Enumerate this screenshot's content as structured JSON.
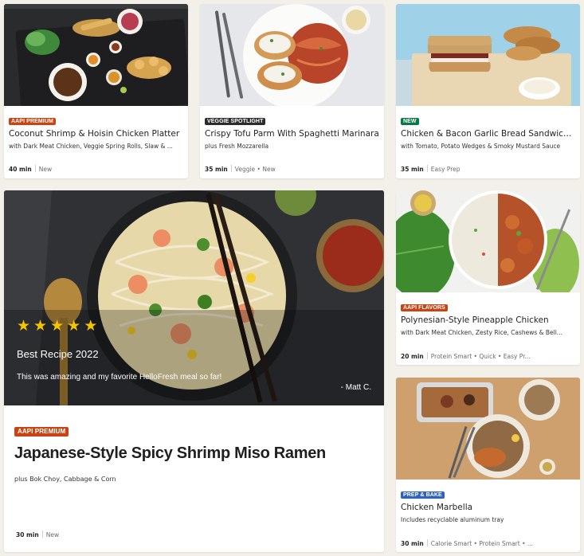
{
  "cards": [
    {
      "badge": "AAPI PREMIUM",
      "title": "Coconut Shrimp & Hoisin Chicken Platter",
      "subtitle": "with Dark Meat Chicken, Veggie Spring Rolls, Slaw & ...",
      "time": "40 min",
      "tags": "New"
    },
    {
      "badge": "VEGGIE SPOTLIGHT",
      "title": "Crispy Tofu Parm With Spaghetti Marinara",
      "subtitle": "plus Fresh Mozzarella",
      "time": "35 min",
      "tags": "Veggie • New"
    },
    {
      "badge": "NEW",
      "title": "Chicken & Bacon Garlic Bread Sandwich...",
      "subtitle": "with Tomato, Potato Wedges & Smoky Mustard Sauce",
      "time": "35 min",
      "tags": "Easy Prep"
    },
    {
      "badge": "AAPI FLAVORS",
      "title": "Polynesian-Style Pineapple Chicken",
      "subtitle": "with Dark Meat Chicken, Zesty Rice, Cashews & Bell...",
      "time": "20 min",
      "tags": "Protein Smart • Quick • Easy Pr..."
    },
    {
      "badge": "PREP & BAKE",
      "title": "Chicken Marbella",
      "subtitle": "Includes recyclable aluminum tray",
      "time": "30 min",
      "tags": "Calorie Smart • Protein Smart • ..."
    }
  ],
  "featured": {
    "badge": "AAPI PREMIUM",
    "title": "Japanese-Style Spicy Shrimp Miso Ramen",
    "subtitle": "plus Bok Choy, Cabbage & Corn",
    "time": "30 min",
    "tags": "New",
    "rating": 5,
    "review_title": "Best Recipe 2022",
    "review_text": "This was amazing and my favorite HelloFresh meal so far!",
    "review_author": "- Matt C."
  },
  "colors": {
    "badge_orange": "#c84413",
    "badge_dark": "#2b2b2b",
    "badge_green": "#067a46",
    "badge_blue": "#2e62c0",
    "star": "#f5c400"
  }
}
